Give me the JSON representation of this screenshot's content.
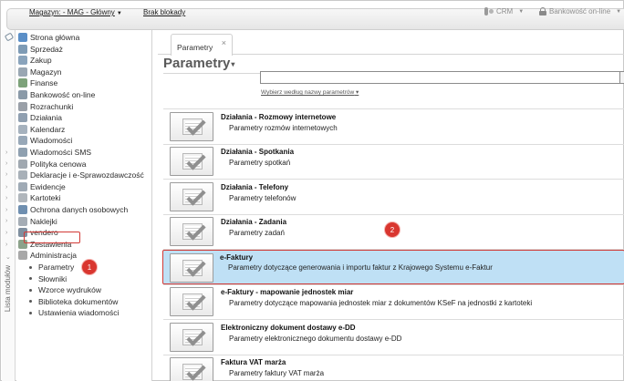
{
  "topbar": {
    "warehouse_label": "Magazyn: - MAG - Główny",
    "block_label": "Brak blokady",
    "crm_label": "CRM",
    "banking_label": "Bankowość on-line"
  },
  "sidebar": {
    "vertical_label": "Lista modułów",
    "items": [
      {
        "label": "Strona główna",
        "icon": "home-icon",
        "color": "#5b8fc7"
      },
      {
        "label": "Sprzedaż",
        "icon": "sales-icon",
        "color": "#7e9bb5"
      },
      {
        "label": "Zakup",
        "icon": "purchase-icon",
        "color": "#8aa4bc"
      },
      {
        "label": "Magazyn",
        "icon": "warehouse-icon",
        "color": "#9aa7b3"
      },
      {
        "label": "Finanse",
        "icon": "finance-icon",
        "color": "#7da27a"
      },
      {
        "label": "Bankowość on-line",
        "icon": "bank-icon",
        "color": "#8a9aa8"
      },
      {
        "label": "Rozrachunki",
        "icon": "settlements-icon",
        "color": "#9aa0a8"
      },
      {
        "label": "Działania",
        "icon": "actions-icon",
        "color": "#8f9fb0"
      },
      {
        "label": "Kalendarz",
        "icon": "calendar-icon",
        "color": "#a6b2be"
      },
      {
        "label": "Wiadomości",
        "icon": "messages-icon",
        "color": "#98a8b8"
      },
      {
        "label": "Wiadomości SMS",
        "icon": "sms-icon",
        "color": "#8fa0b0"
      },
      {
        "label": "Polityka cenowa",
        "icon": "pricing-icon",
        "color": "#a0a8b0"
      },
      {
        "label": "Deklaracje i e-Sprawozdawczość",
        "icon": "declarations-icon",
        "color": "#a8b0b8"
      },
      {
        "label": "Ewidencje",
        "icon": "records-icon",
        "color": "#9faab5"
      },
      {
        "label": "Kartoteki",
        "icon": "files-icon",
        "color": "#b0b6bc"
      },
      {
        "label": "Ochrona danych osobowych",
        "icon": "data-protection-icon",
        "color": "#6f8fb0"
      },
      {
        "label": "Naklejki",
        "icon": "labels-icon",
        "color": "#a5adb5"
      },
      {
        "label": "vendero",
        "icon": "vendero-icon",
        "color": "#7f8f9f"
      },
      {
        "label": "Zestawienia",
        "icon": "reports-icon",
        "color": "#8ca28a"
      },
      {
        "label": "Administracja",
        "icon": "administration-icon",
        "color": "#a8a8a8"
      }
    ],
    "sub_items": [
      {
        "label": "Parametry"
      },
      {
        "label": "Słowniki"
      },
      {
        "label": "Wzorce wydruków"
      },
      {
        "label": "Biblioteka dokumentów"
      },
      {
        "label": "Ustawienia wiadomości"
      }
    ]
  },
  "badges": {
    "one": "1",
    "two": "2"
  },
  "tabs": [
    {
      "label": "Parametry",
      "close": "×"
    }
  ],
  "main": {
    "title": "Parametry",
    "search_value": "",
    "filter_label": "Wybierz według nazwy parametrów"
  },
  "rows": [
    {
      "title": "Działania - Rozmowy internetowe",
      "desc": "Parametry rozmów internetowych"
    },
    {
      "title": "Działania - Spotkania",
      "desc": "Parametry spotkań"
    },
    {
      "title": "Działania - Telefony",
      "desc": "Parametry telefonów"
    },
    {
      "title": "Działania - Zadania",
      "desc": "Parametry zadań"
    },
    {
      "title": "e-Faktury",
      "desc": "Parametry dotyczące generowania i importu faktur z Krajowego Systemu e-Faktur",
      "selected": true
    },
    {
      "title": "e-Faktury - mapowanie jednostek miar",
      "desc": "Parametry dotyczące mapowania jednostek miar z dokumentów KSeF na jednostki z kartoteki"
    },
    {
      "title": "Elektroniczny dokument dostawy e-DD",
      "desc": "Parametry elektronicznego dokumentu dostawy e-DD"
    },
    {
      "title": "Faktura VAT marża",
      "desc": "Parametry faktury VAT marża"
    }
  ],
  "colors": {
    "selected_row": "#bfe0f5",
    "callout": "#d23a36"
  }
}
